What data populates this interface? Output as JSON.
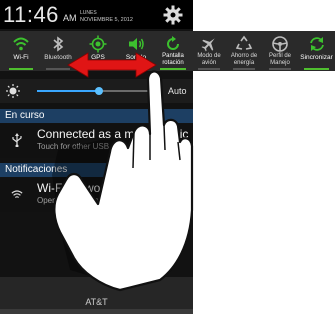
{
  "status_bar": {
    "time": "11:46",
    "ampm": "AM",
    "day": "LUNES",
    "date": "NOVIEMBRE 5, 2012",
    "settings_icon": "gear-icon"
  },
  "quick_toggles": [
    {
      "label": "Wi-Fi",
      "icon": "wifi-icon",
      "on": true
    },
    {
      "label": "Bluetooth",
      "icon": "bluetooth-icon",
      "on": false
    },
    {
      "label": "GPS",
      "icon": "gps-icon",
      "on": true
    },
    {
      "label": "Sonido",
      "icon": "sound-icon",
      "on": true
    },
    {
      "label": "Pantalla rotación",
      "icon": "rotate-icon",
      "on": true
    },
    {
      "label": "Modo de avión",
      "icon": "airplane-icon",
      "on": false
    },
    {
      "label": "Ahorro de energía",
      "icon": "recycle-icon",
      "on": false
    },
    {
      "label": "Perfil de Manejo",
      "icon": "steering-wheel-icon",
      "on": false
    },
    {
      "label": "Sincronizar",
      "icon": "sync-icon",
      "on": true
    }
  ],
  "brightness": {
    "icon": "brightness-icon",
    "level": 0.52,
    "auto_label": "Auto"
  },
  "sections": {
    "ongoing": "En curso",
    "notifications": "Notificaciones"
  },
  "ongoing_items": [
    {
      "icon": "usb-icon",
      "title": "Connected as a media devic",
      "subtitle": "Touch for other USB options."
    }
  ],
  "notification_items": [
    {
      "icon": "wifi-network-icon",
      "title": "Wi-Fi networks available",
      "subtitle": "Open Wi-Fi settings"
    }
  ],
  "carrier": "AT&T",
  "colors": {
    "accent_green": "#4fbf2f",
    "section_blue": "#1d3f63",
    "arrow_red": "#e01515",
    "slider_blue": "#3aa7ff"
  },
  "gesture": {
    "hand_icon": "pointing-hand-icon",
    "arrow_icon": "double-arrow-icon"
  }
}
